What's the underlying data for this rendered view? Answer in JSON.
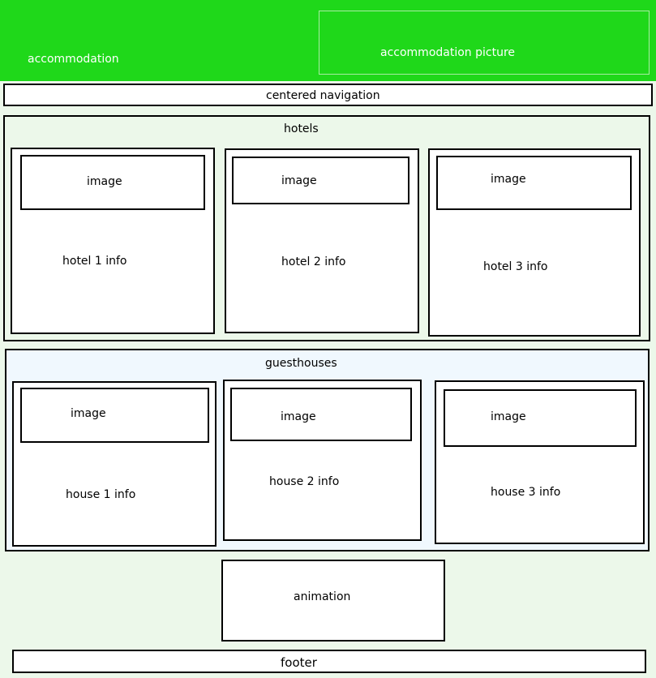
{
  "header": {
    "title": "accommodation",
    "picture_label": "accommodation picture",
    "background": "#1fd81a"
  },
  "nav": {
    "label": "centered navigation"
  },
  "hotels": {
    "heading": "hotels",
    "cards": [
      {
        "image": "image",
        "info": "hotel 1 info"
      },
      {
        "image": "image",
        "info": "hotel 2 info"
      },
      {
        "image": "image",
        "info": "hotel 3 info"
      }
    ]
  },
  "guesthouses": {
    "heading": "guesthouses",
    "cards": [
      {
        "image": "image",
        "info": "house 1 info"
      },
      {
        "image": "image",
        "info": "house 2 info"
      },
      {
        "image": "image",
        "info": "house 3 info"
      }
    ]
  },
  "animation": {
    "label": "animation"
  },
  "footer": {
    "label": "footer"
  }
}
